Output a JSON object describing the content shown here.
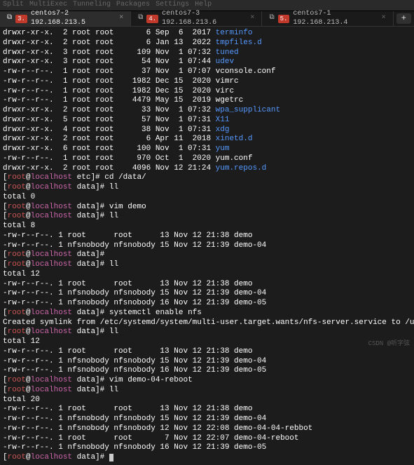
{
  "menubar": {
    "items": [
      "Split",
      "MultiExec",
      "Tunneling",
      "Packages",
      "Settings",
      "Help"
    ]
  },
  "tabs": [
    {
      "num": "3.",
      "label": "centos7-2 192.168.213.5",
      "active": true
    },
    {
      "num": "4.",
      "label": "centos7-3 192.168.213.6",
      "active": false
    },
    {
      "num": "5.",
      "label": "centos7-1 192.168.213.4",
      "active": false
    }
  ],
  "close_x": "×",
  "add_plus": "+",
  "ls_rows": [
    {
      "perm": "drwxr-xr-x.",
      "n": "2",
      "own": "root root",
      "size": "6",
      "date": "Sep  6  2017",
      "name": "terminfo",
      "cls": "blue"
    },
    {
      "perm": "drwxr-xr-x.",
      "n": "2",
      "own": "root root",
      "size": "6",
      "date": "Jan 13  2022",
      "name": "tmpfiles.d",
      "cls": "blue"
    },
    {
      "perm": "drwxr-xr-x.",
      "n": "3",
      "own": "root root",
      "size": "109",
      "date": "Nov  1 07:32",
      "name": "tuned",
      "cls": "blue"
    },
    {
      "perm": "drwxr-xr-x.",
      "n": "3",
      "own": "root root",
      "size": "54",
      "date": "Nov  1 07:44",
      "name": "udev",
      "cls": "blue"
    },
    {
      "perm": "-rw-r--r--.",
      "n": "1",
      "own": "root root",
      "size": "37",
      "date": "Nov  1 07:07",
      "name": "vconsole.conf",
      "cls": ""
    },
    {
      "perm": "-rw-r--r--.",
      "n": "1",
      "own": "root root",
      "size": "1982",
      "date": "Dec 15  2020",
      "name": "vimrc",
      "cls": ""
    },
    {
      "perm": "-rw-r--r--.",
      "n": "1",
      "own": "root root",
      "size": "1982",
      "date": "Dec 15  2020",
      "name": "virc",
      "cls": ""
    },
    {
      "perm": "-rw-r--r--.",
      "n": "1",
      "own": "root root",
      "size": "4479",
      "date": "May 15  2019",
      "name": "wgetrc",
      "cls": ""
    },
    {
      "perm": "drwxr-xr-x.",
      "n": "2",
      "own": "root root",
      "size": "33",
      "date": "Nov  1 07:32",
      "name": "wpa_supplicant",
      "cls": "blue"
    },
    {
      "perm": "drwxr-xr-x.",
      "n": "5",
      "own": "root root",
      "size": "57",
      "date": "Nov  1 07:31",
      "name": "X11",
      "cls": "blue"
    },
    {
      "perm": "drwxr-xr-x.",
      "n": "4",
      "own": "root root",
      "size": "38",
      "date": "Nov  1 07:31",
      "name": "xdg",
      "cls": "blue"
    },
    {
      "perm": "drwxr-xr-x.",
      "n": "2",
      "own": "root root",
      "size": "6",
      "date": "Apr 11  2018",
      "name": "xinetd.d",
      "cls": "blue"
    },
    {
      "perm": "drwxr-xr-x.",
      "n": "6",
      "own": "root root",
      "size": "100",
      "date": "Nov  1 07:31",
      "name": "yum",
      "cls": "blue"
    },
    {
      "perm": "-rw-r--r--.",
      "n": "1",
      "own": "root root",
      "size": "970",
      "date": "Oct  1  2020",
      "name": "yum.conf",
      "cls": ""
    },
    {
      "perm": "drwxr-xr-x.",
      "n": "2",
      "own": "root root",
      "size": "4096",
      "date": "Nov 12 21:24",
      "name": "yum.repos.d",
      "cls": "blue"
    }
  ],
  "sessions": [
    {
      "prompt_dir": "etc",
      "cmd": "cd /data/"
    },
    {
      "prompt_dir": "data",
      "cmd": "ll"
    }
  ],
  "totals": {
    "t0": "total 0",
    "t8": "total 8",
    "t12": "total 12",
    "t20": "total 20"
  },
  "p": {
    "user": "root",
    "at": "@",
    "host": "localhost",
    "etc": " etc]# ",
    "data": " data]# ",
    "lb": "["
  },
  "cmds": {
    "cd": "cd /data/",
    "ll": "ll",
    "vimdemo": "vim demo",
    "enable": "systemctl enable nfs",
    "vim04": "vim demo-04-reboot"
  },
  "symlink": "Created symlink from /etc/systemd/system/multi-user.target.wants/nfs-server.service to /usr/lib/systemd/system/system.",
  "data_rows_a": [
    {
      "perm": "-rw-r--r--.",
      "own": "1 root      root      ",
      "size": "13",
      "date": "Nov 12 21:38",
      "name": "demo"
    },
    {
      "perm": "-rw-r--r--.",
      "own": "1 nfsnobody nfsnobody ",
      "size": "15",
      "date": "Nov 12 21:39",
      "name": "demo-04"
    }
  ],
  "data_rows_b": [
    {
      "perm": "-rw-r--r--.",
      "own": "1 root      root      ",
      "size": "13",
      "date": "Nov 12 21:38",
      "name": "demo"
    },
    {
      "perm": "-rw-r--r--.",
      "own": "1 nfsnobody nfsnobody ",
      "size": "15",
      "date": "Nov 12 21:39",
      "name": "demo-04"
    },
    {
      "perm": "-rw-r--r--.",
      "own": "1 nfsnobody nfsnobody ",
      "size": "16",
      "date": "Nov 12 21:39",
      "name": "demo-05"
    }
  ],
  "data_rows_c": [
    {
      "perm": "-rw-r--r--.",
      "own": "1 root      root      ",
      "size": "13",
      "date": "Nov 12 21:38",
      "name": "demo"
    },
    {
      "perm": "-rw-r--r--.",
      "own": "1 nfsnobody nfsnobody ",
      "size": "15",
      "date": "Nov 12 21:39",
      "name": "demo-04"
    },
    {
      "perm": "-rw-r--r--.",
      "own": "1 nfsnobody nfsnobody ",
      "size": "16",
      "date": "Nov 12 21:39",
      "name": "demo-05"
    }
  ],
  "data_rows_d": [
    {
      "perm": "-rw-r--r--.",
      "own": "1 root      root      ",
      "size": "13",
      "date": "Nov 12 21:38",
      "name": "demo"
    },
    {
      "perm": "-rw-r--r--.",
      "own": "1 nfsnobody nfsnobody ",
      "size": "15",
      "date": "Nov 12 21:39",
      "name": "demo-04"
    },
    {
      "perm": "-rw-r--r--.",
      "own": "1 nfsnobody nfsnobody ",
      "size": "12",
      "date": "Nov 12 22:08",
      "name": "demo-04-04-rebbot"
    },
    {
      "perm": "-rw-r--r--.",
      "own": "1 root      root      ",
      "size": " 7",
      "date": "Nov 12 22:07",
      "name": "demo-04-reboot"
    },
    {
      "perm": "-rw-r--r--.",
      "own": "1 nfsnobody nfsnobody ",
      "size": "16",
      "date": "Nov 12 21:39",
      "name": "demo-05"
    }
  ],
  "watermark": "CSDN @听字弦"
}
